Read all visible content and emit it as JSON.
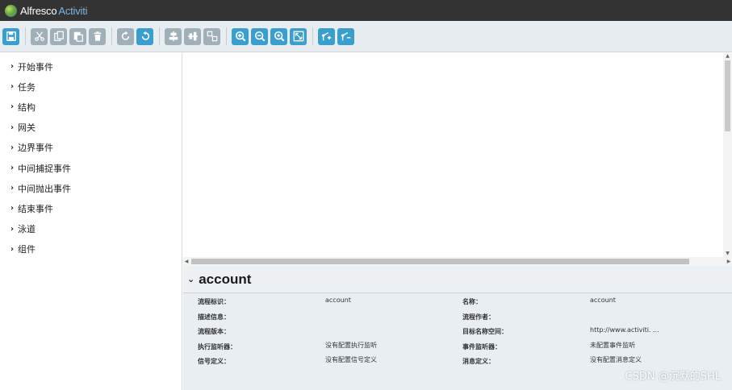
{
  "app": {
    "brand_primary": "Alfresco",
    "brand_secondary": "Activiti"
  },
  "colors": {
    "toolbar_active": "#3a9fcf",
    "toolbar_inactive": "#9fb0b9",
    "titlebar": "#333333",
    "panel_bg": "#e9eef2"
  },
  "toolbar": {
    "groups": [
      [
        {
          "icon": "save-icon",
          "enabled": true
        }
      ],
      [
        {
          "icon": "cut-icon",
          "enabled": false
        },
        {
          "icon": "copy-icon",
          "enabled": false
        },
        {
          "icon": "paste-icon",
          "enabled": false
        },
        {
          "icon": "delete-icon",
          "enabled": false
        }
      ],
      [
        {
          "icon": "redo-icon",
          "enabled": false
        },
        {
          "icon": "undo-icon",
          "enabled": true
        }
      ],
      [
        {
          "icon": "align-horizontal-icon",
          "enabled": false
        },
        {
          "icon": "align-vertical-icon",
          "enabled": false
        },
        {
          "icon": "same-size-icon",
          "enabled": false
        }
      ],
      [
        {
          "icon": "zoom-in-icon",
          "enabled": true
        },
        {
          "icon": "zoom-out-icon",
          "enabled": true
        },
        {
          "icon": "zoom-actual-icon",
          "enabled": true
        },
        {
          "icon": "zoom-fit-icon",
          "enabled": true
        }
      ],
      [
        {
          "icon": "bendpoint-add-icon",
          "enabled": true
        },
        {
          "icon": "bendpoint-remove-icon",
          "enabled": true
        }
      ]
    ]
  },
  "palette": {
    "items": [
      {
        "label": "开始事件"
      },
      {
        "label": "任务"
      },
      {
        "label": "结构"
      },
      {
        "label": "网关"
      },
      {
        "label": "边界事件"
      },
      {
        "label": "中间捕捉事件"
      },
      {
        "label": "中间抛出事件"
      },
      {
        "label": "结束事件"
      },
      {
        "label": "泳道"
      },
      {
        "label": "组件"
      }
    ]
  },
  "properties": {
    "title": "account",
    "rows": [
      {
        "left_label": "流程标识：",
        "left_value": "account",
        "right_label": "名称：",
        "right_value": "account"
      },
      {
        "left_label": "描述信息：",
        "left_value": "",
        "right_label": "流程作者：",
        "right_value": ""
      },
      {
        "left_label": "流程版本：",
        "left_value": "",
        "right_label": "目标名称空间：",
        "right_value": "http://www.activiti. ..."
      },
      {
        "left_label": "执行监听器：",
        "left_value": "没有配置执行监听",
        "right_label": "事件监听器：",
        "right_value": "未配置事件监听"
      },
      {
        "left_label": "信号定义：",
        "left_value": "没有配置信号定义",
        "right_label": "消息定义：",
        "right_value": "没有配置消息定义"
      }
    ]
  },
  "watermark": "CSDN @沉默的SHL"
}
